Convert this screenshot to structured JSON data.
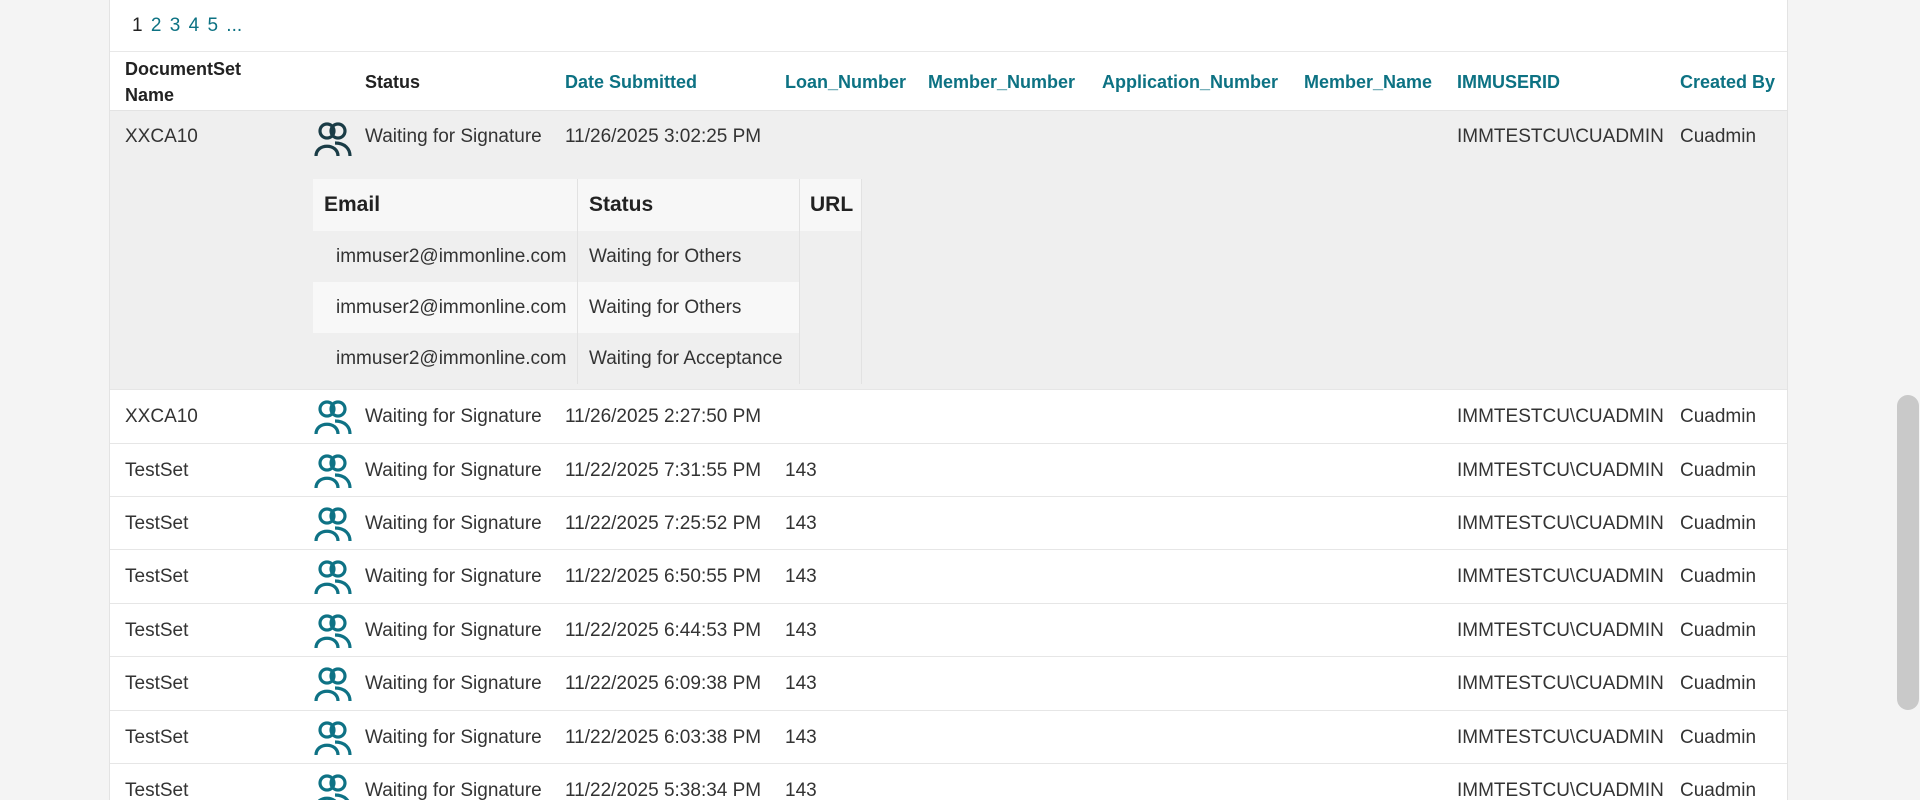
{
  "pagination": {
    "pages": [
      "1",
      "2",
      "3",
      "4",
      "5",
      "..."
    ]
  },
  "columns": {
    "name": "DocumentSet\nName",
    "status": "Status",
    "date": "Date Submitted",
    "loan": "Loan_Number",
    "member_number": "Member_Number",
    "application": "Application_Number",
    "member_name": "Member_Name",
    "userid": "IMMUSERID",
    "created_by": "Created By"
  },
  "rows": [
    {
      "name": "XXCA10",
      "icon": "signers-icon",
      "status": "Waiting for Signature",
      "date": "11/26/2025 3:02:25 PM",
      "loan": "",
      "userid": "IMMTESTCU\\CUADMIN",
      "created_by": "Cuadmin"
    },
    {
      "name": "XXCA10",
      "icon": "signers-icon",
      "status": "Waiting for Signature",
      "date": "11/26/2025 2:27:50 PM",
      "loan": "",
      "userid": "IMMTESTCU\\CUADMIN",
      "created_by": "Cuadmin"
    },
    {
      "name": "TestSet",
      "icon": "signers-icon",
      "status": "Waiting for Signature",
      "date": "11/22/2025 7:31:55 PM",
      "loan": "143",
      "userid": "IMMTESTCU\\CUADMIN",
      "created_by": "Cuadmin"
    },
    {
      "name": "TestSet",
      "icon": "signers-icon",
      "status": "Waiting for Signature",
      "date": "11/22/2025 7:25:52 PM",
      "loan": "143",
      "userid": "IMMTESTCU\\CUADMIN",
      "created_by": "Cuadmin"
    },
    {
      "name": "TestSet",
      "icon": "signers-icon",
      "status": "Waiting for Signature",
      "date": "11/22/2025 6:50:55 PM",
      "loan": "143",
      "userid": "IMMTESTCU\\CUADMIN",
      "created_by": "Cuadmin"
    },
    {
      "name": "TestSet",
      "icon": "signers-icon",
      "status": "Waiting for Signature",
      "date": "11/22/2025 6:44:53 PM",
      "loan": "143",
      "userid": "IMMTESTCU\\CUADMIN",
      "created_by": "Cuadmin"
    },
    {
      "name": "TestSet",
      "icon": "signers-icon",
      "status": "Waiting for Signature",
      "date": "11/22/2025 6:09:38 PM",
      "loan": "143",
      "userid": "IMMTESTCU\\CUADMIN",
      "created_by": "Cuadmin"
    },
    {
      "name": "TestSet",
      "icon": "signers-icon",
      "status": "Waiting for Signature",
      "date": "11/22/2025 6:03:38 PM",
      "loan": "143",
      "userid": "IMMTESTCU\\CUADMIN",
      "created_by": "Cuadmin"
    },
    {
      "name": "TestSet",
      "icon": "signers-icon",
      "status": "Waiting for Signature",
      "date": "11/22/2025 5:38:34 PM",
      "loan": "143",
      "userid": "IMMTESTCU\\CUADMIN",
      "created_by": "Cuadmin"
    }
  ],
  "detail": {
    "headers": {
      "email": "Email",
      "status": "Status",
      "url": "URL"
    },
    "rows": [
      {
        "email": "immuser2@immonline.com",
        "status": "Waiting for Others",
        "url": ""
      },
      {
        "email": "immuser2@immonline.com",
        "status": "Waiting for Others",
        "url": ""
      },
      {
        "email": "immuser2@immonline.com",
        "status": "Waiting for Acceptance",
        "url": ""
      }
    ]
  },
  "colors": {
    "accent": "#0d7283",
    "icon_dark": "#1a3c46",
    "icon_teal": "#0e7285",
    "expanded_bg": "#efefef"
  }
}
